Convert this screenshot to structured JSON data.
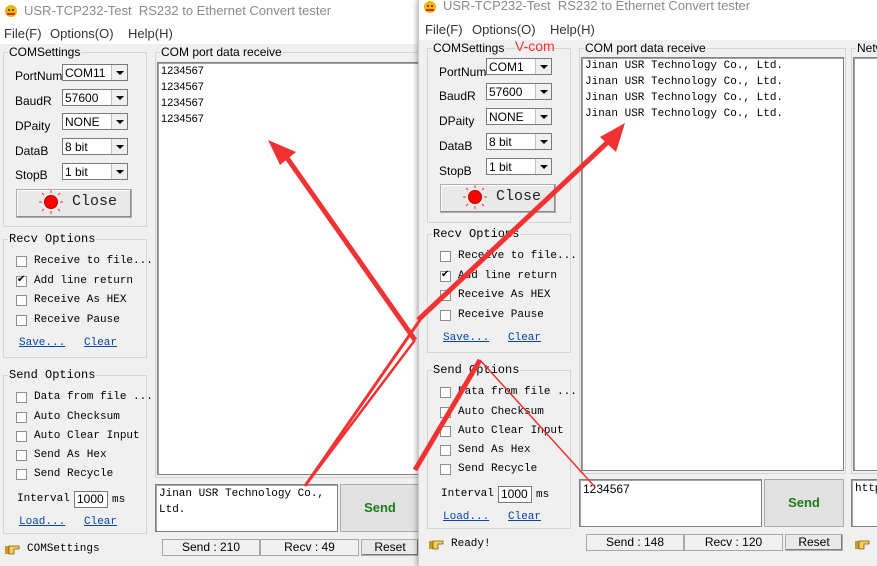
{
  "annotation": {
    "vcom_label": "V-com",
    "arrow_color": "#f03232"
  },
  "windows": [
    {
      "title": "USR-TCP232-Test  RS232 to Ethernet Convert tester",
      "menu": [
        "File(F)",
        "Options(O)",
        "Help(H)"
      ],
      "com_settings": {
        "legend": "COMSettings",
        "fields": [
          {
            "label": "PortNum",
            "value": "COM11"
          },
          {
            "label": "BaudR",
            "value": "57600"
          },
          {
            "label": "DPaity",
            "value": "NONE"
          },
          {
            "label": "DataB",
            "value": "8 bit"
          },
          {
            "label": "StopB",
            "value": "1 bit"
          }
        ],
        "button": "Close"
      },
      "recv_options": {
        "legend": "Recv Options",
        "checks": [
          {
            "label": "Receive to file...",
            "checked": false
          },
          {
            "label": "Add line return",
            "checked": true
          },
          {
            "label": "Receive As HEX",
            "checked": false
          },
          {
            "label": "Receive Pause",
            "checked": false
          }
        ],
        "save": "Save...",
        "clear": "Clear"
      },
      "send_options": {
        "legend": "Send Options",
        "checks": [
          {
            "label": "Data from file ...",
            "checked": false
          },
          {
            "label": "Auto Checksum",
            "checked": false
          },
          {
            "label": "Auto Clear Input",
            "checked": false
          },
          {
            "label": "Send As Hex",
            "checked": false
          },
          {
            "label": "Send Recycle",
            "checked": false
          }
        ],
        "interval_label": "Interval",
        "interval_value": "1000",
        "interval_unit": "ms",
        "load": "Load...",
        "clear": "Clear"
      },
      "receive_panel": {
        "legend": "COM port data receive",
        "lines": [
          "1234567",
          "1234567",
          "1234567",
          "1234567"
        ]
      },
      "send_text": "Jinan USR Technology Co., Ltd.",
      "send_button": "Send",
      "status": "COMSettings",
      "send_count": "Send : 210",
      "recv_count": "Recv : 49",
      "reset": "Reset"
    },
    {
      "title": "USR-TCP232-Test  RS232 to Ethernet Convert tester",
      "menu": [
        "File(F)",
        "Options(O)",
        "Help(H)"
      ],
      "com_settings": {
        "legend": "COMSettings",
        "fields": [
          {
            "label": "PortNum",
            "value": "COM1"
          },
          {
            "label": "BaudR",
            "value": "57600"
          },
          {
            "label": "DPaity",
            "value": "NONE"
          },
          {
            "label": "DataB",
            "value": "8 bit"
          },
          {
            "label": "StopB",
            "value": "1 bit"
          }
        ],
        "button": "Close"
      },
      "recv_options": {
        "legend": "Recv Options",
        "checks": [
          {
            "label": "Receive to file...",
            "checked": false
          },
          {
            "label": "Add line return",
            "checked": true
          },
          {
            "label": "Receive As HEX",
            "checked": false
          },
          {
            "label": "Receive Pause",
            "checked": false
          }
        ],
        "save": "Save...",
        "clear": "Clear"
      },
      "send_options": {
        "legend": "Send Options",
        "checks": [
          {
            "label": "Data from file ...",
            "checked": false
          },
          {
            "label": "Auto Checksum",
            "checked": false
          },
          {
            "label": "Auto Clear Input",
            "checked": false
          },
          {
            "label": "Send As Hex",
            "checked": false
          },
          {
            "label": "Send Recycle",
            "checked": false
          }
        ],
        "interval_label": "Interval",
        "interval_value": "1000",
        "interval_unit": "ms",
        "load": "Load...",
        "clear": "Clear"
      },
      "receive_panel": {
        "legend": "COM port data receive",
        "lines": [
          "Jinan USR Technology Co., Ltd.",
          "Jinan USR Technology Co., Ltd.",
          "Jinan USR Technology Co., Ltd.",
          "Jinan USR Technology Co., Ltd."
        ]
      },
      "network_panel": {
        "legend": "Netw",
        "send_text": "http"
      },
      "send_text": "1234567",
      "send_button": "Send",
      "status": "Ready!",
      "send_count": "Send : 148",
      "recv_count": "Recv : 120",
      "reset": "Reset"
    }
  ]
}
